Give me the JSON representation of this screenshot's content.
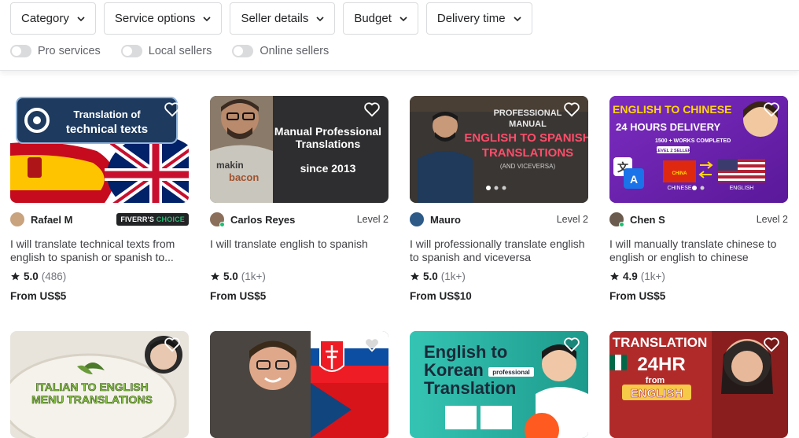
{
  "filters": [
    {
      "label": "Category"
    },
    {
      "label": "Service options"
    },
    {
      "label": "Seller details"
    },
    {
      "label": "Budget"
    },
    {
      "label": "Delivery time"
    }
  ],
  "toggles": [
    {
      "label": "Pro services",
      "on": false
    },
    {
      "label": "Local sellers",
      "on": false
    },
    {
      "label": "Online sellers",
      "on": false
    }
  ],
  "gigs": [
    {
      "seller": "Rafael M",
      "badge": {
        "prefix": "FIVERR'S",
        "suffix": "CHOICE"
      },
      "title": "I will translate technical texts from english to spanish or spanish to...",
      "score": "5.0",
      "count": "(486)",
      "price": "From US$5",
      "thumb_text": [
        "Translation of",
        "technical texts"
      ]
    },
    {
      "seller": "Carlos Reyes",
      "level": "Level 2",
      "title": "I will translate english to spanish",
      "score": "5.0",
      "count": "(1k+)",
      "price": "From US$5",
      "thumb_text": [
        "Manual Professional",
        "Translations",
        "since 2013",
        "makin",
        "bacon"
      ]
    },
    {
      "seller": "Mauro",
      "level": "Level 2",
      "title": "I will professionally translate english to spanish and viceversa",
      "score": "5.0",
      "count": "(1k+)",
      "price": "From US$10",
      "thumb_text": [
        "PROFESSIONAL",
        "MANUAL",
        "ENGLISH TO SPANISH",
        "TRANSLATIONS",
        "(AND VICEVERSA)"
      ]
    },
    {
      "seller": "Chen S",
      "level": "Level 2",
      "title": "I will manually translate chinese to english or english to chinese",
      "score": "4.9",
      "count": "(1k+)",
      "price": "From US$5",
      "thumb_text": [
        "ENGLISH TO CHINESE",
        "24 HOURS DELIVERY",
        "1500 + WORKS COMPLETED",
        "LEVEL 2 SELLER",
        "CHINESE",
        "ENGLISH",
        "CHINA"
      ]
    }
  ],
  "gigs_row2": [
    {
      "thumb_text": [
        "ITALIAN TO ENGLISH",
        "MENU TRANSLATIONS"
      ]
    },
    {
      "thumb_text": []
    },
    {
      "thumb_text": [
        "English to",
        "Korean",
        "Translation",
        "professional"
      ]
    },
    {
      "thumb_text": [
        "TRANSLATION",
        "24HR",
        "from",
        "ENGLISH"
      ]
    }
  ],
  "colors": {
    "accent_green": "#1dbf73",
    "text_dark": "#222325",
    "text_muted": "#74767e",
    "border": "#dadbdd"
  }
}
